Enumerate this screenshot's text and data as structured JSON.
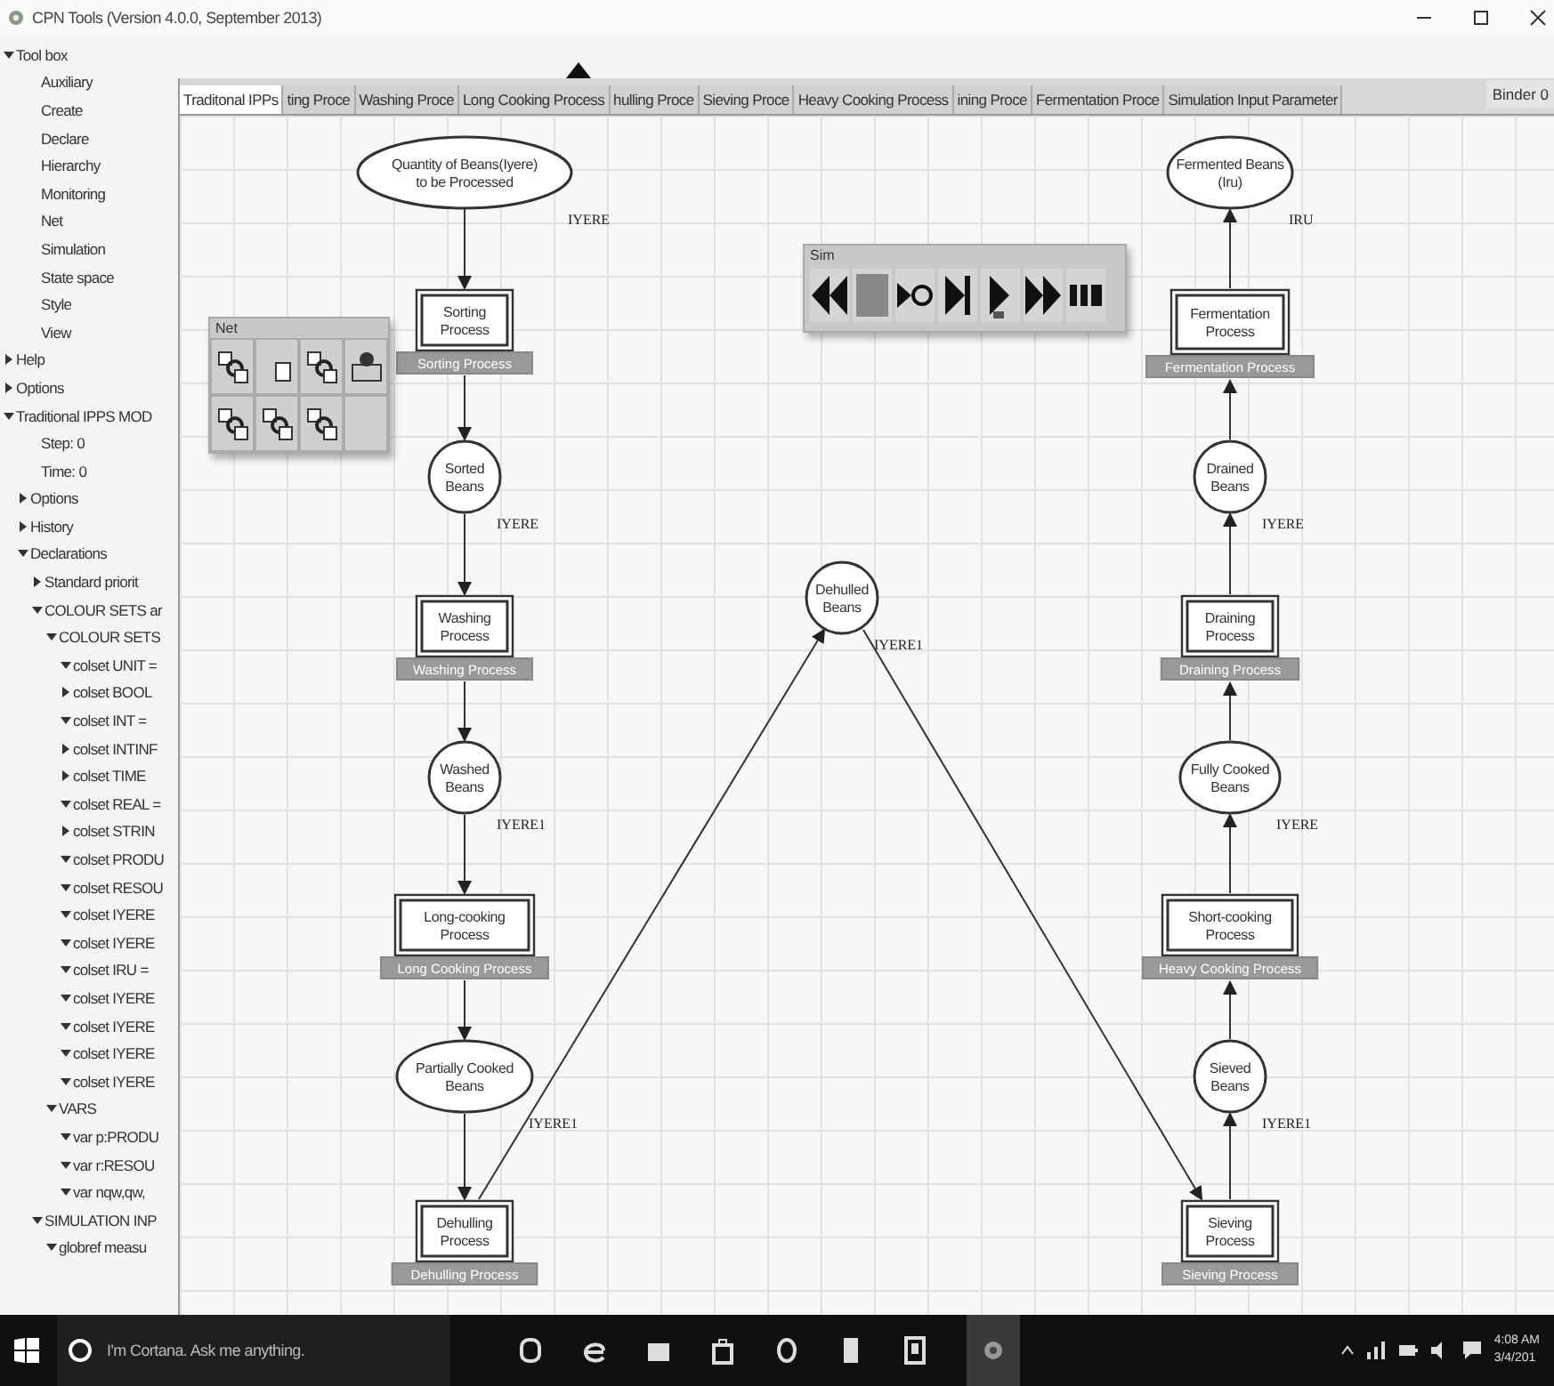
{
  "window": {
    "title": "CPN Tools (Version 4.0.0, September 2013)"
  },
  "sidebar": {
    "items": [
      {
        "label": "Tool box",
        "expanded": true,
        "children": [
          {
            "label": "Auxiliary"
          },
          {
            "label": "Create"
          },
          {
            "label": "Declare"
          },
          {
            "label": "Hierarchy"
          },
          {
            "label": "Monitoring"
          },
          {
            "label": "Net"
          },
          {
            "label": "Simulation"
          },
          {
            "label": "State space"
          },
          {
            "label": "Style"
          },
          {
            "label": "View"
          }
        ]
      },
      {
        "label": "Help",
        "expanded": false
      },
      {
        "label": "Options",
        "expanded": false
      },
      {
        "label": "Traditional IPPS MOD",
        "expanded": true,
        "children": [
          {
            "label": "Step: 0"
          },
          {
            "label": "Time: 0"
          },
          {
            "label": "Options",
            "expanded": false
          },
          {
            "label": "History",
            "expanded": false
          },
          {
            "label": "Declarations",
            "expanded": true,
            "children": [
              {
                "label": "Standard priorit",
                "expanded": false
              },
              {
                "label": "COLOUR SETS ar",
                "expanded": true,
                "children": [
                  {
                    "label": "COLOUR SETS",
                    "expanded": true,
                    "children": [
                      {
                        "label": "colset UNIT =",
                        "expanded": true
                      },
                      {
                        "label": "colset BOOL",
                        "expanded": false
                      },
                      {
                        "label": "colset INT =",
                        "expanded": true
                      },
                      {
                        "label": "colset INTINF",
                        "expanded": false
                      },
                      {
                        "label": "colset TIME",
                        "expanded": false
                      },
                      {
                        "label": "colset REAL =",
                        "expanded": true
                      },
                      {
                        "label": "colset STRIN",
                        "expanded": false
                      },
                      {
                        "label": "colset PRODU",
                        "expanded": true
                      },
                      {
                        "label": "colset RESOU",
                        "expanded": true
                      },
                      {
                        "label": "colset IYERE",
                        "expanded": true
                      },
                      {
                        "label": "colset IYERE",
                        "expanded": true
                      },
                      {
                        "label": "colset IRU =",
                        "expanded": true
                      },
                      {
                        "label": "colset IYERE",
                        "expanded": true
                      },
                      {
                        "label": "colset IYERE",
                        "expanded": true
                      },
                      {
                        "label": "colset IYERE",
                        "expanded": true
                      },
                      {
                        "label": "colset IYERE",
                        "expanded": true
                      }
                    ]
                  },
                  {
                    "label": "VARS",
                    "expanded": true,
                    "children": [
                      {
                        "label": "var p:PRODU",
                        "expanded": true
                      },
                      {
                        "label": "var r:RESOU",
                        "expanded": true
                      },
                      {
                        "label": "var nqw,qw,",
                        "expanded": true
                      }
                    ]
                  }
                ]
              },
              {
                "label": "SIMULATION INP",
                "expanded": true,
                "children": [
                  {
                    "label": "globref measu",
                    "expanded": true
                  }
                ]
              }
            ]
          }
        ]
      }
    ]
  },
  "tabs": [
    {
      "label": "Traditonal IPPs",
      "selected": true
    },
    {
      "label": "ting Proce",
      "selected": false
    },
    {
      "label": "Washing Proce",
      "selected": false
    },
    {
      "label": "Long Cooking Process",
      "selected": false
    },
    {
      "label": "hulling Proce",
      "selected": false
    },
    {
      "label": "Sieving Proce",
      "selected": false
    },
    {
      "label": "Heavy Cooking Process",
      "selected": false
    },
    {
      "label": "ining Proce",
      "selected": false
    },
    {
      "label": "Fermentation Proce",
      "selected": false
    },
    {
      "label": "Simulation Input Parameter",
      "selected": false
    }
  ],
  "binder": "Binder 0",
  "net": {
    "places": [
      {
        "name": "Quantity of Beans(Iyere) to be Processed",
        "colour_set": "IYERE"
      },
      {
        "name": "Sorted Beans",
        "colour_set": "IYERE"
      },
      {
        "name": "Washed Beans",
        "colour_set": "IYERE1"
      },
      {
        "name": "Partially Cooked Beans",
        "colour_set": "IYERE1"
      },
      {
        "name": "Dehulled Beans",
        "colour_set": "IYERE1"
      },
      {
        "name": "Fermented Beans (Iru)",
        "colour_set": "IRU"
      },
      {
        "name": "Drained Beans",
        "colour_set": "IYERE"
      },
      {
        "name": "Fully Cooked Beans",
        "colour_set": "IYERE"
      },
      {
        "name": "Sieved Beans",
        "colour_set": "IYERE1"
      }
    ],
    "transitions": [
      {
        "name": "Sorting Process",
        "subpage": "Sorting Process"
      },
      {
        "name": "Washing Process",
        "subpage": "Washing Process"
      },
      {
        "name": "Long-cooking Process",
        "subpage": "Long Cooking Process"
      },
      {
        "name": "Dehulling Process",
        "subpage": "Dehulling Process"
      },
      {
        "name": "Fermentation Process",
        "subpage": "Fermentation Process"
      },
      {
        "name": "Draining Process",
        "subpage": "Draining Process"
      },
      {
        "name": "Short-cooking Process",
        "subpage": "Heavy Cooking Process"
      },
      {
        "name": "Sieving Process",
        "subpage": "Sieving Process"
      }
    ]
  },
  "net_palette": {
    "title": "Net"
  },
  "sim_palette": {
    "title": "Sim"
  },
  "taskbar": {
    "search_placeholder": "I'm Cortana. Ask me anything.",
    "time": "4:08 AM",
    "date": "3/4/201"
  }
}
